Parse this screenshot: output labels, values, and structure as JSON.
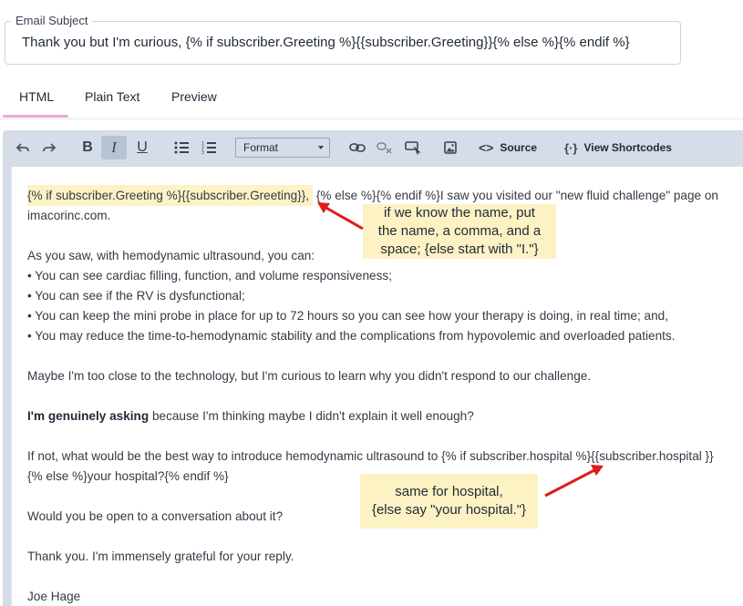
{
  "subject": {
    "legend": "Email Subject",
    "value": "Thank you but I'm curious, {% if subscriber.Greeting %}{{subscriber.Greeting}}{% else %}{% endif %}"
  },
  "tabs": [
    {
      "label": "HTML",
      "active": true
    },
    {
      "label": "Plain Text",
      "active": false
    },
    {
      "label": "Preview",
      "active": false
    }
  ],
  "toolbar": {
    "format_label": "Format",
    "source_label": "Source",
    "shortcodes_label": "View Shortcodes",
    "italic_active": true
  },
  "body": {
    "line1_highlight": "{% if subscriber.Greeting %}{{subscriber.Greeting}},",
    "line1_rest": " {% else %}{% endif %}I saw you visited our \"new fluid challenge\" page on",
    "line2": "imacorinc.com.",
    "line3": "As you saw, with hemodynamic ultrasound, you can:",
    "bullet1": "• You can see cardiac filling, function, and volume responsiveness;",
    "bullet2": "• You can see if the RV is dysfunctional;",
    "bullet3": "• You can keep the mini probe in place for up to 72 hours so you can see how your therapy is doing, in real time; and,",
    "bullet4": "• You may reduce the time-to-hemodynamic stability and the complications from hypovolemic and overloaded patients.",
    "para_maybe": "Maybe I'm too close to the technology, but I'm curious to learn why you didn't respond to our challenge.",
    "asking_bold": "I'm genuinely asking",
    "asking_rest": " because I'm thinking maybe I didn't explain it well enough?",
    "ifnot_line1": "If not, what would be the best way to introduce hemodynamic ultrasound to {% if subscriber.hospital %}{{subscriber.hospital }}",
    "ifnot_line2": "{% else %}your hospital?{% endif %}",
    "open_line": "Would you be open to a conversation about it?",
    "thanks_line": "Thank you. I'm immensely grateful for your reply.",
    "signature": "Joe Hage"
  },
  "annotations": {
    "greeting_note_1": "if we know the name, put",
    "greeting_note_2": "the name, a comma, and a",
    "greeting_note_3": "space; {else start with \"I.\"}",
    "hospital_note_1": "same for hospital,",
    "hospital_note_2": "{else say \"your hospital.\"}",
    "arrow_color": "#e01b1b",
    "highlight_color": "#fdf2c4"
  }
}
